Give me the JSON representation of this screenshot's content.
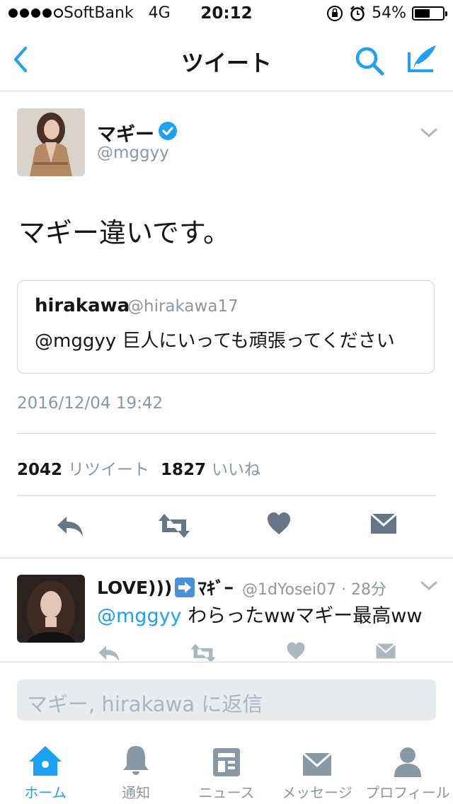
{
  "status_bar": {
    "carrier": "SoftBank",
    "network": "4G",
    "time": "20:12",
    "battery": "54%",
    "battery_level": 0.54
  },
  "nav": {
    "title": "ツイート"
  },
  "tweet": {
    "name": "マギー",
    "handle": "@mggyy",
    "text": "マギー違いです。",
    "quote": {
      "name": "hirakawa",
      "handle": "@hirakawa17",
      "text": "@mggyy 巨人にいっても頑張ってください"
    },
    "date": "2016/12/04 19:42",
    "retweet_count": "2042",
    "retweet_label": "リツイート",
    "like_count": "1827",
    "like_label": "いいね"
  },
  "reply_tweet": {
    "name": "LOVE)))",
    "name_suffix": "ﾏｷﾞｰ",
    "handle_time": "@1dYosei07 · 28分",
    "mention": "@mggyy",
    "text": " わらったwwマギー最高ww"
  },
  "reply_input": {
    "placeholder": "マギー, hirakawa に返信"
  },
  "tabs": [
    {
      "label": "ホーム",
      "icon": "home-icon"
    },
    {
      "label": "通知",
      "icon": "bell-icon"
    },
    {
      "label": "ニュース",
      "icon": "news-icon"
    },
    {
      "label": "メッセージ",
      "icon": "envelope-icon"
    },
    {
      "label": "プロフィール",
      "icon": "person-icon"
    }
  ],
  "colors": {
    "accent": "#1da1f2",
    "muted": "#8899a6",
    "icon": "#657786"
  }
}
